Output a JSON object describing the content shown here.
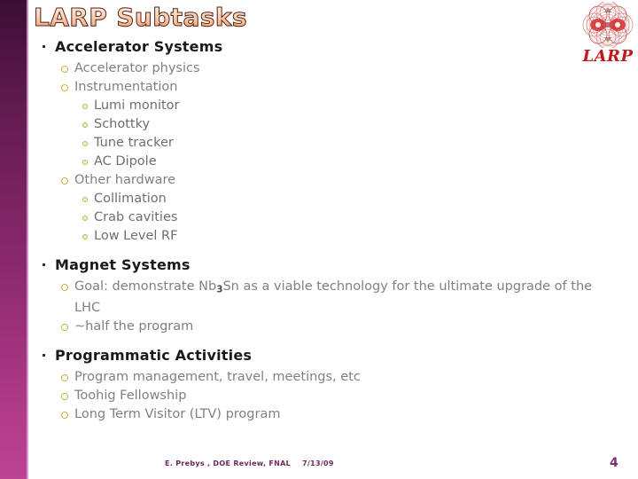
{
  "slide": {
    "title": "LARP Subtasks",
    "page_number": "4",
    "accent_purple": "#7c3070",
    "bar_top_color": "#3a0f33",
    "bar_bottom_color": "#bd4394",
    "bullet_color": "#c9b347",
    "body_text_color": "#808080",
    "heading_text_color": "#1a1a1a",
    "background_color": "#ffffff"
  },
  "logo": {
    "name": "larp-logo",
    "text": "LARP",
    "color": "#c0181d"
  },
  "outline": {
    "sections": [
      {
        "heading": "Accelerator Systems",
        "items": [
          {
            "label": "Accelerator physics",
            "children": []
          },
          {
            "label": "Instrumentation",
            "children": [
              "Lumi monitor",
              "Schottky",
              "Tune tracker",
              "AC Dipole"
            ]
          },
          {
            "label": "Other hardware",
            "children": [
              "Collimation",
              "Crab cavities",
              "Low Level RF"
            ]
          }
        ]
      },
      {
        "heading": "Magnet Systems",
        "items": [
          {
            "label_pre": "Goal: demonstrate Nb",
            "label_sub": "3",
            "label_post": "Sn as a viable technology for the ultimate upgrade of the LHC",
            "children": []
          },
          {
            "label": "~half the program",
            "children": []
          }
        ]
      },
      {
        "heading": "Programmatic Activities",
        "items": [
          {
            "label": "Program management, travel, meetings, etc",
            "children": []
          },
          {
            "label": "Toohig Fellowship",
            "children": []
          },
          {
            "label": "Long Term Visitor (LTV) program",
            "children": []
          }
        ]
      }
    ]
  },
  "footer": {
    "credit": "E. Prebys , DOE Review, FNAL",
    "date": "7/13/09"
  }
}
